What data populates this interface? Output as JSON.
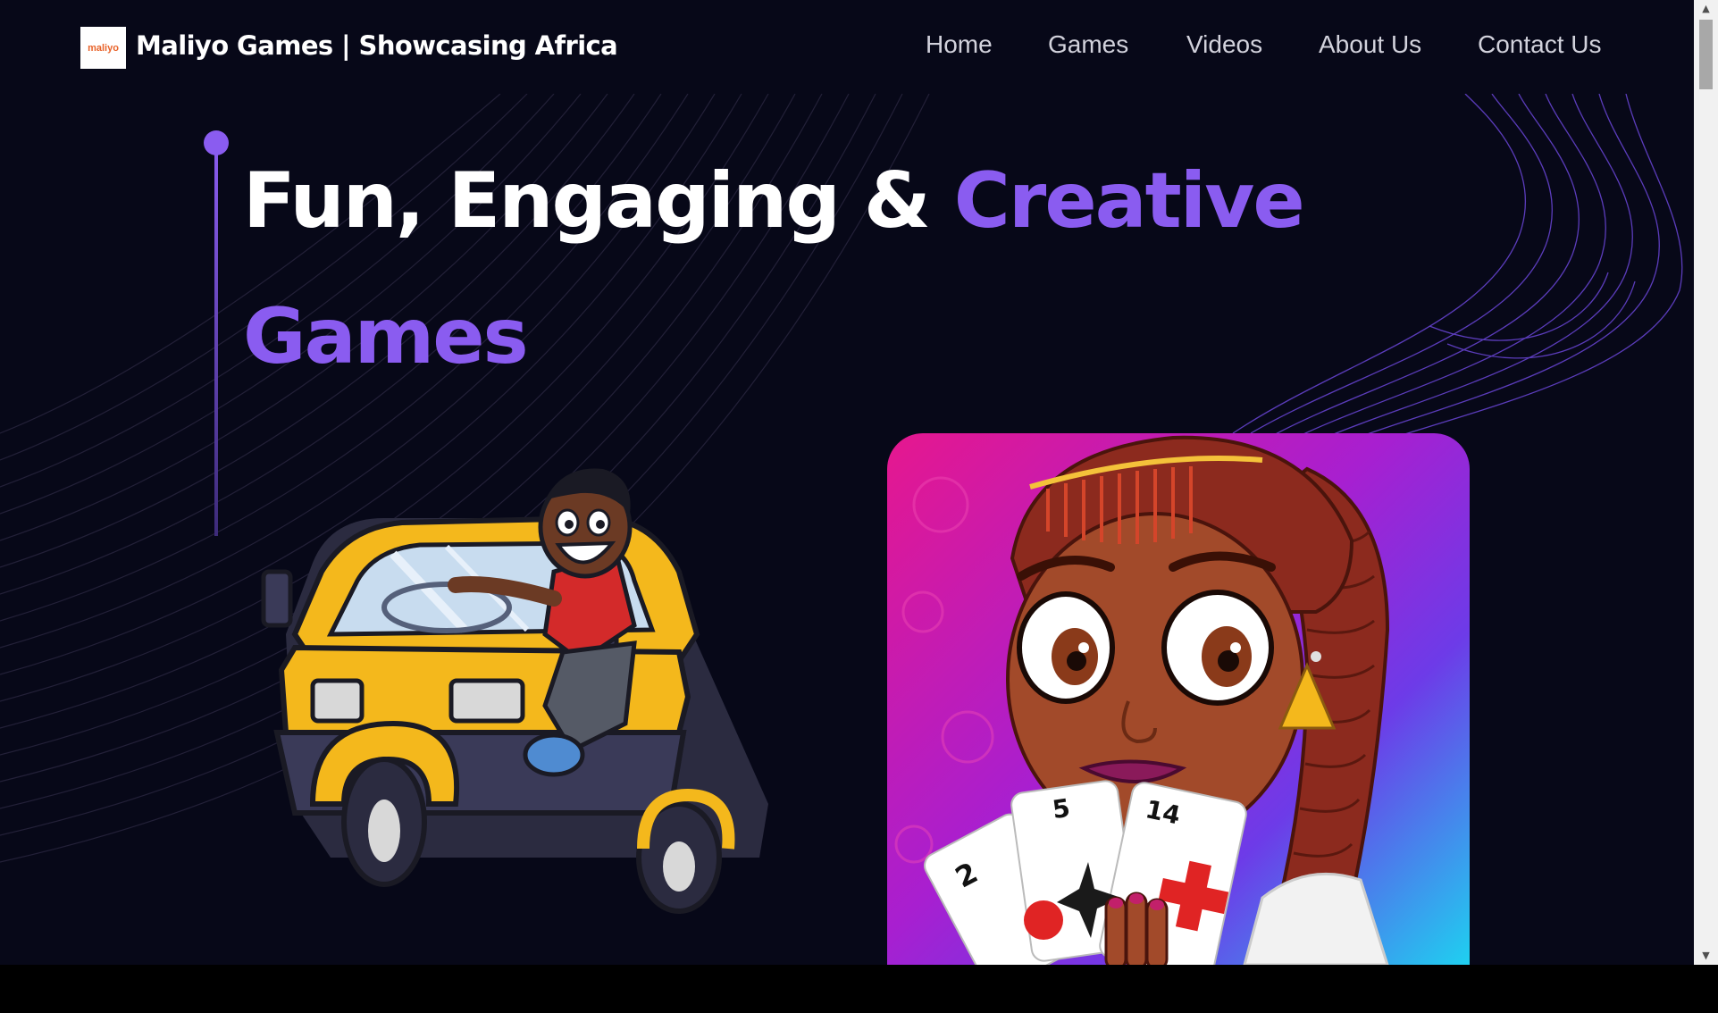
{
  "header": {
    "logo_text": "maliyo",
    "site_title": "Maliyo Games | Showcasing Africa"
  },
  "nav": {
    "items": [
      {
        "label": "Home"
      },
      {
        "label": "Games"
      },
      {
        "label": "Videos"
      },
      {
        "label": "About Us"
      },
      {
        "label": "Contact Us"
      }
    ]
  },
  "hero": {
    "headline_part1": "Fun, Engaging & ",
    "headline_accent": "Creative",
    "headline_line2": "Games"
  },
  "cards": {
    "card_numbers": [
      "2",
      "5",
      "14"
    ]
  },
  "icons": {
    "scroll_up": "scroll-up-arrow-icon",
    "scroll_down": "scroll-down-arrow-icon"
  },
  "colors": {
    "background": "#070818",
    "accent": "#8a5cf0",
    "logo_orange": "#e8632a",
    "nav_text": "#d2d2dc",
    "tuktuk_yellow": "#f4b81c"
  }
}
